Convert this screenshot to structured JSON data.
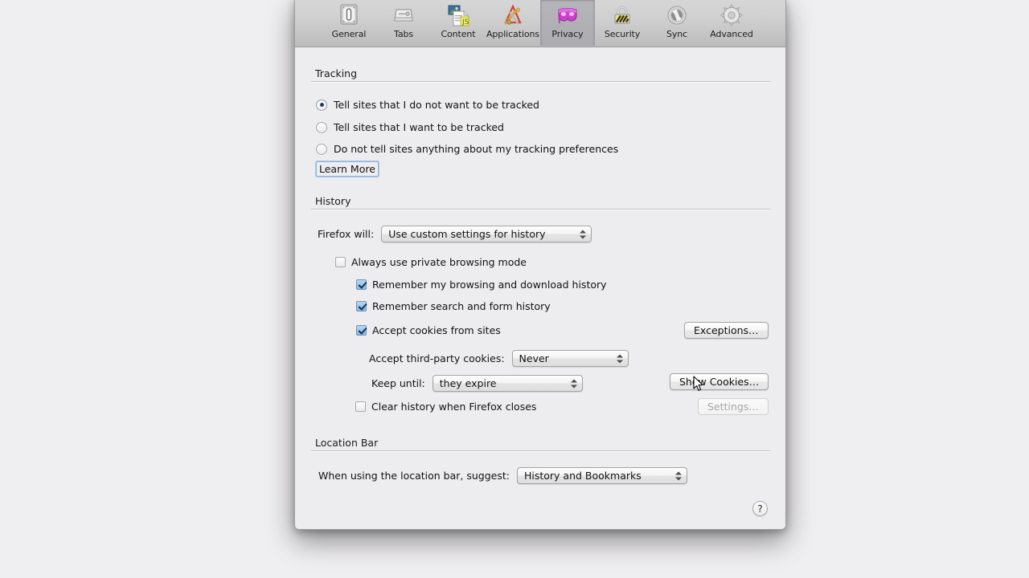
{
  "toolbar": {
    "items": [
      {
        "label": "General",
        "icon": "general-icon",
        "selected": false
      },
      {
        "label": "Tabs",
        "icon": "tabs-icon",
        "selected": false
      },
      {
        "label": "Content",
        "icon": "content-icon",
        "selected": false
      },
      {
        "label": "Applications",
        "icon": "applications-icon",
        "selected": false
      },
      {
        "label": "Privacy",
        "icon": "privacy-mask-icon",
        "selected": true
      },
      {
        "label": "Security",
        "icon": "security-lock-icon",
        "selected": false
      },
      {
        "label": "Sync",
        "icon": "sync-icon",
        "selected": false
      },
      {
        "label": "Advanced",
        "icon": "advanced-gear-icon",
        "selected": false
      }
    ]
  },
  "tracking": {
    "title": "Tracking",
    "options": [
      {
        "label": "Tell sites that I do not want to be tracked",
        "selected": true
      },
      {
        "label": "Tell sites that I want to be tracked",
        "selected": false
      },
      {
        "label": "Do not tell sites anything about my tracking preferences",
        "selected": false
      }
    ],
    "learn_more_label": "Learn More"
  },
  "history": {
    "title": "History",
    "firefox_will_label": "Firefox will:",
    "firefox_will_value": "Use custom settings for history",
    "always_private_label": "Always use private browsing mode",
    "always_private_checked": false,
    "remember_browsing_label": "Remember my browsing and download history",
    "remember_browsing_checked": true,
    "remember_search_label": "Remember search and form history",
    "remember_search_checked": true,
    "accept_cookies_label": "Accept cookies from sites",
    "accept_cookies_checked": true,
    "exceptions_label": "Exceptions…",
    "third_party_label": "Accept third-party cookies:",
    "third_party_value": "Never",
    "keep_until_label": "Keep until:",
    "keep_until_value": "they expire",
    "show_cookies_label": "Show Cookies…",
    "clear_history_label": "Clear history when Firefox closes",
    "clear_history_checked": false,
    "settings_label": "Settings…",
    "settings_disabled": true
  },
  "location_bar": {
    "title": "Location Bar",
    "suggest_label": "When using the location bar, suggest:",
    "suggest_value": "History and Bookmarks"
  },
  "help": {
    "glyph": "?"
  },
  "colors": {
    "window_bg": "#ededef",
    "toolbar_bg": "#cfcfcf",
    "selected_tab_bg": "#b0b0b4",
    "accent_checkbox": "#87b9e8",
    "focus_ring": "#8fb4e0",
    "desktop_bg": "#efeef0"
  }
}
